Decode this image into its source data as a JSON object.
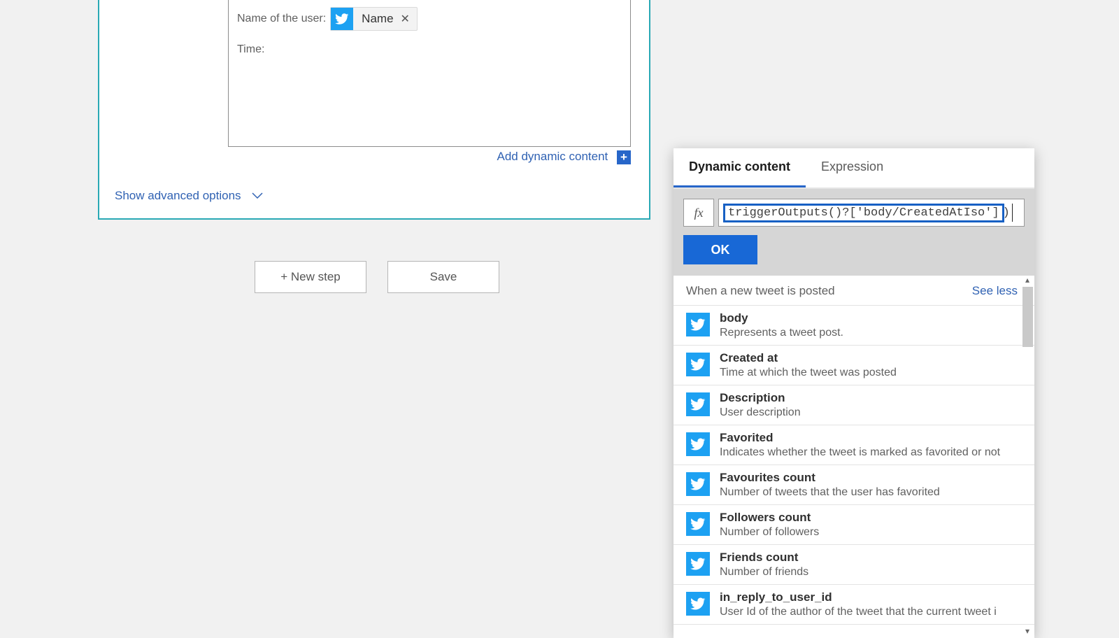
{
  "action": {
    "line1_label": "Name of the user:",
    "line1_token_label": "Name",
    "line2_label": "Time:",
    "add_dynamic": "Add dynamic content",
    "show_advanced": "Show advanced options"
  },
  "buttons": {
    "new_step": "+ New step",
    "save": "Save"
  },
  "popup": {
    "tab_dynamic": "Dynamic content",
    "tab_expression": "Expression",
    "fx_symbol": "fx",
    "expression_highlight": "triggerOutputs()?['body/CreatedAtIso']",
    "expression_trail": ")",
    "ok": "OK",
    "trigger_header": "When a new tweet is posted",
    "see_less": "See less",
    "items": [
      {
        "title": "body",
        "desc": "Represents a tweet post."
      },
      {
        "title": "Created at",
        "desc": "Time at which the tweet was posted"
      },
      {
        "title": "Description",
        "desc": "User description"
      },
      {
        "title": "Favorited",
        "desc": "Indicates whether the tweet is marked as favorited or not"
      },
      {
        "title": "Favourites count",
        "desc": "Number of tweets that the user has favorited"
      },
      {
        "title": "Followers count",
        "desc": "Number of followers"
      },
      {
        "title": "Friends count",
        "desc": "Number of friends"
      },
      {
        "title": "in_reply_to_user_id",
        "desc": "User Id of the author of the tweet that the current tweet i"
      }
    ]
  }
}
